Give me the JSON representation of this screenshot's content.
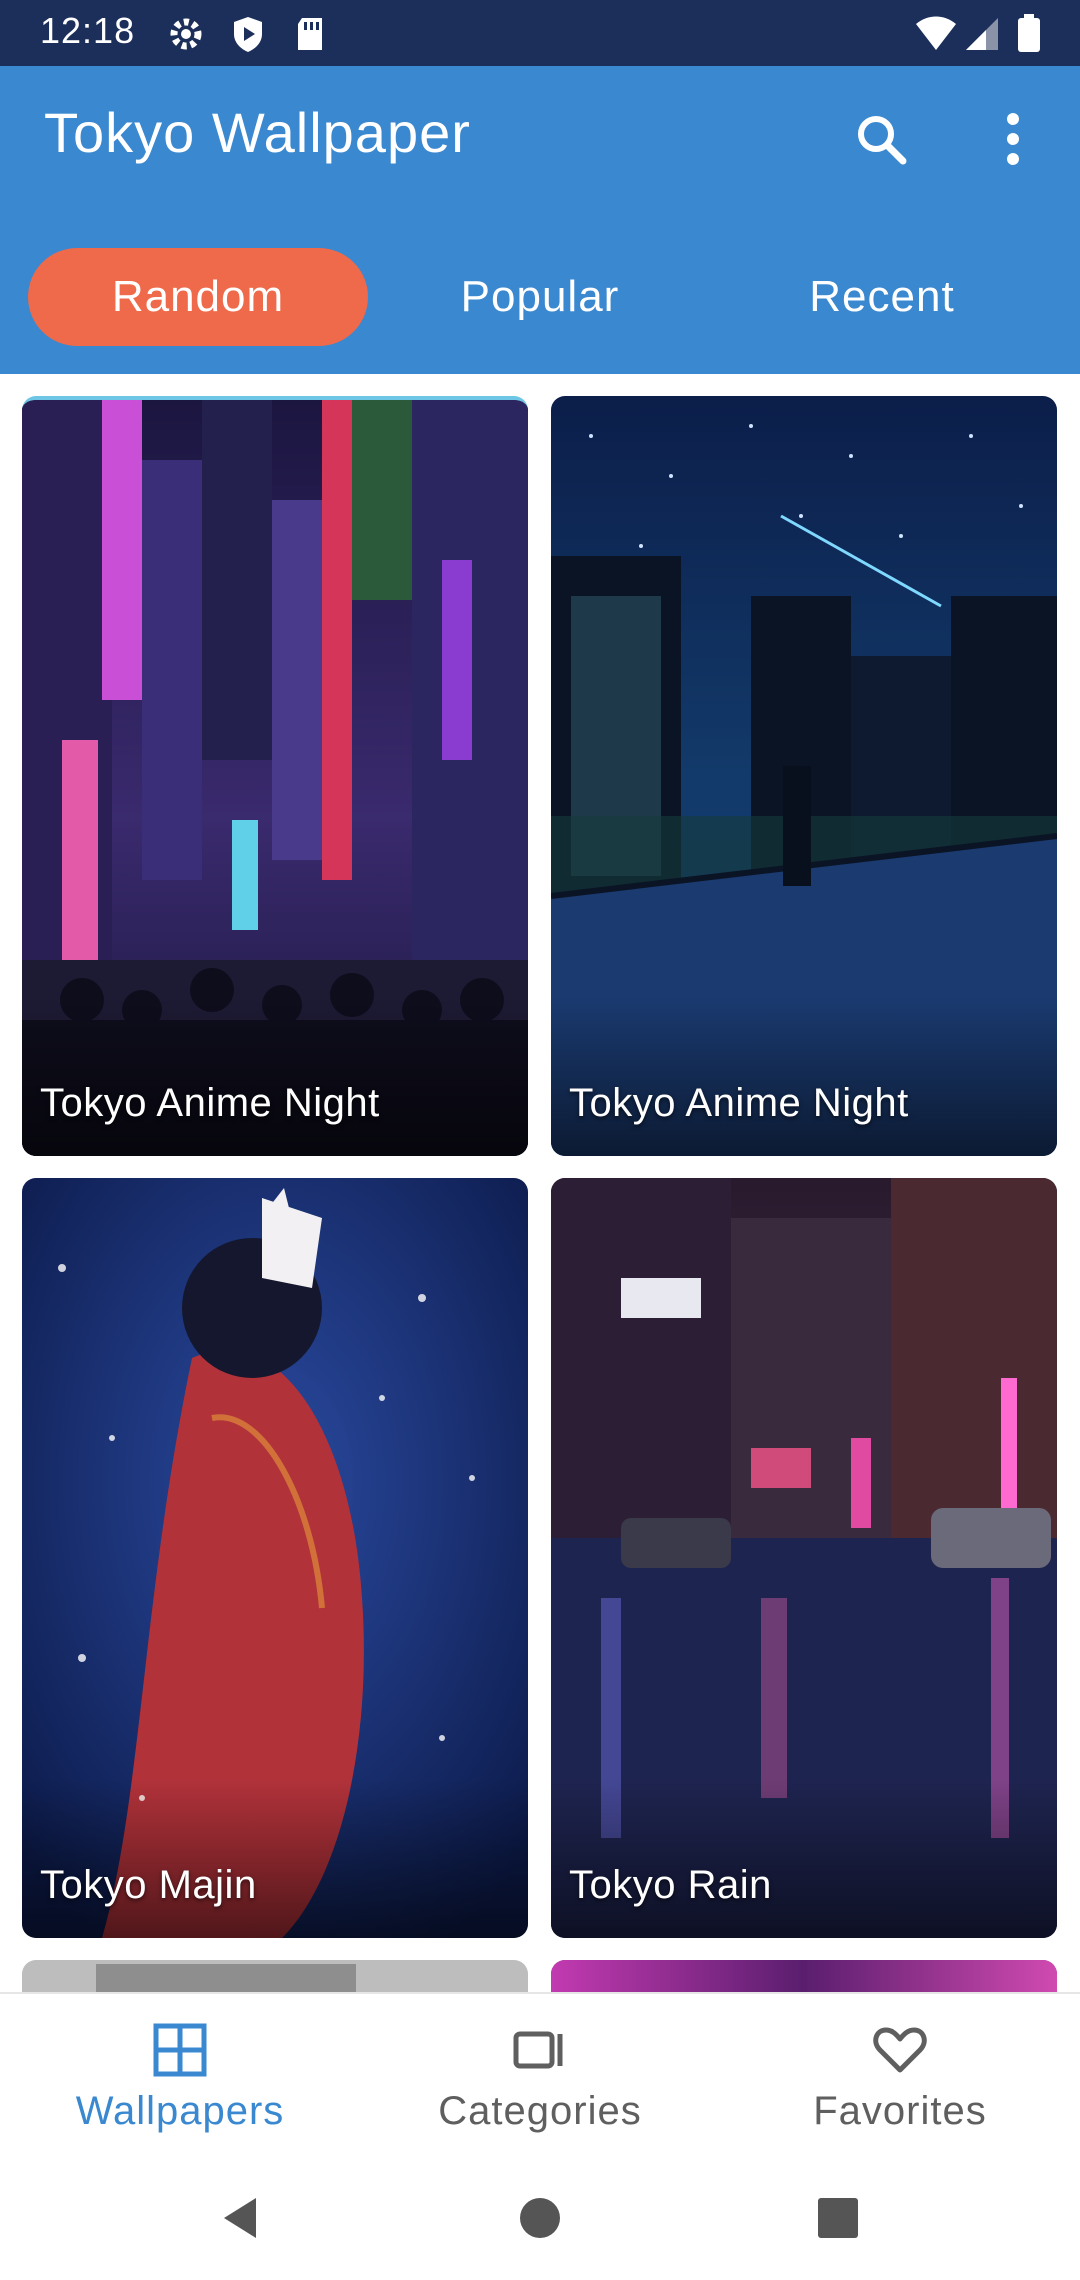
{
  "status_bar": {
    "time": "12:18"
  },
  "app_bar": {
    "title": "Tokyo Wallpaper"
  },
  "tabs": [
    {
      "label": "Random",
      "active": true
    },
    {
      "label": "Popular",
      "active": false
    },
    {
      "label": "Recent",
      "active": false
    }
  ],
  "wallpapers": [
    {
      "title": "Tokyo Anime Night"
    },
    {
      "title": "Tokyo Anime Night"
    },
    {
      "title": "Tokyo Majin"
    },
    {
      "title": "Tokyo Rain"
    }
  ],
  "bottom_nav": [
    {
      "label": "Wallpapers",
      "icon": "grid-icon",
      "active": true
    },
    {
      "label": "Categories",
      "icon": "categories-icon",
      "active": false
    },
    {
      "label": "Favorites",
      "icon": "heart-icon",
      "active": false
    }
  ],
  "colors": {
    "status_bar": "#1c2f5a",
    "app_bar": "#3a88d0",
    "accent": "#ef6a4a",
    "nav_active": "#3a88d0",
    "nav_inactive": "#5f5f5f"
  }
}
